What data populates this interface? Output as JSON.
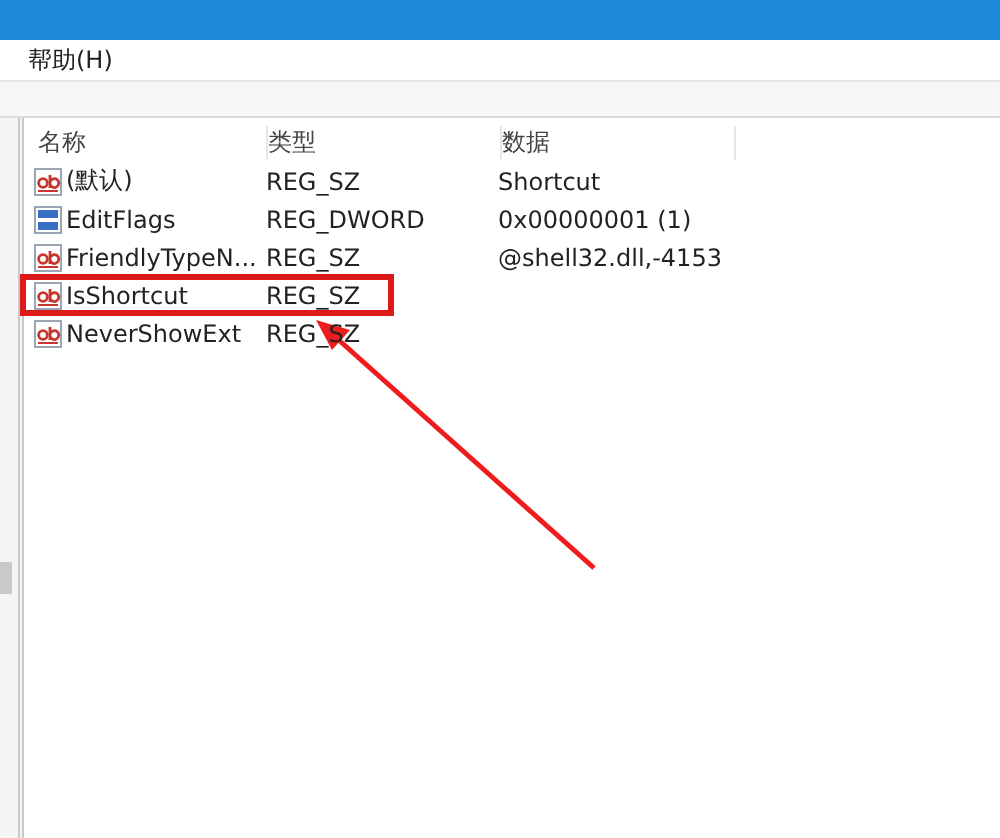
{
  "menu": [
    {
      "label": "帮助(H)"
    }
  ],
  "columns": [
    "名称",
    "类型",
    "数据"
  ],
  "values": [
    {
      "kind": "string",
      "name": "(默认)",
      "type": "REG_SZ",
      "data": "Shortcut",
      "highlighted": false
    },
    {
      "kind": "binary",
      "name": "EditFlags",
      "type": "REG_DWORD",
      "data": "0x00000001 (1)",
      "highlighted": false
    },
    {
      "kind": "string",
      "name": "FriendlyTypeN...",
      "type": "REG_SZ",
      "data": "@shell32.dll,-4153",
      "highlighted": false
    },
    {
      "kind": "string",
      "name": "IsShortcut",
      "type": "REG_SZ",
      "highlighted": true
    },
    {
      "kind": "string",
      "name": "NeverShowExt",
      "type": "REG_SZ",
      "highlighted": false
    }
  ]
}
